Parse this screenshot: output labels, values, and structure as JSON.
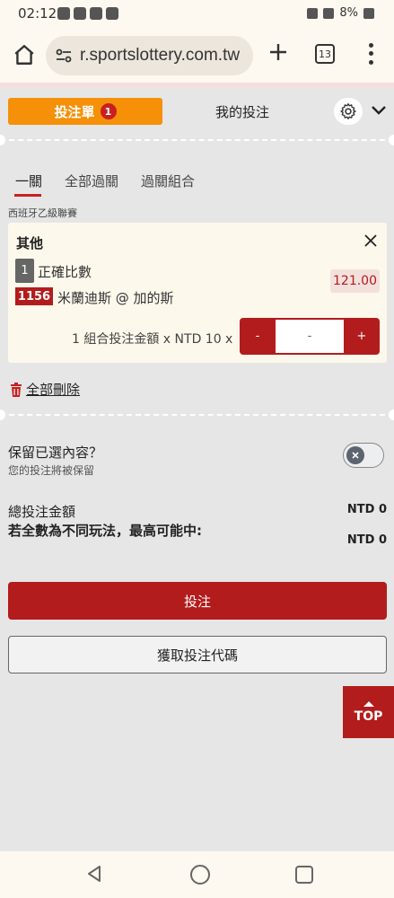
{
  "status_bar": {
    "time": "02:12",
    "battery": "8%"
  },
  "browser": {
    "url": "r.sportslottery.com.tw",
    "tab_count": "13"
  },
  "header": {
    "betslip_label": "投注單",
    "betslip_count": "1",
    "mybets_label": "我的投注"
  },
  "sub_tabs": {
    "single": "一關",
    "all_parlay": "全部過關",
    "parlay_combo": "過關組合"
  },
  "bet": {
    "league": "西班牙乙級聯賽",
    "category": "其他",
    "market_number": "1",
    "market_name": "正確比數",
    "odds": "121.00",
    "game_code": "1156",
    "teams": "米蘭迪斯 @ 加的斯",
    "amount_label": "1 組合投注金額 x NTD 10 x",
    "stepper_minus": "-",
    "stepper_value": "-",
    "stepper_plus": "+"
  },
  "actions": {
    "delete_all": "全部刪除",
    "keep_title": "保留已選內容？",
    "keep_subtitle": "您的投注將被保留",
    "total_label": "總投注金額",
    "total_value": "NTD 0",
    "max_win_label": "若全數為不同玩法，最高可能中:",
    "max_win_value": "NTD 0",
    "bet_button": "投注",
    "get_code_button": "獲取投注代碼",
    "top_button": "TOP"
  },
  "colors": {
    "accent_red": "#b21c1c",
    "tab_orange": "#f59008",
    "page_bg": "#e6e6e6"
  }
}
